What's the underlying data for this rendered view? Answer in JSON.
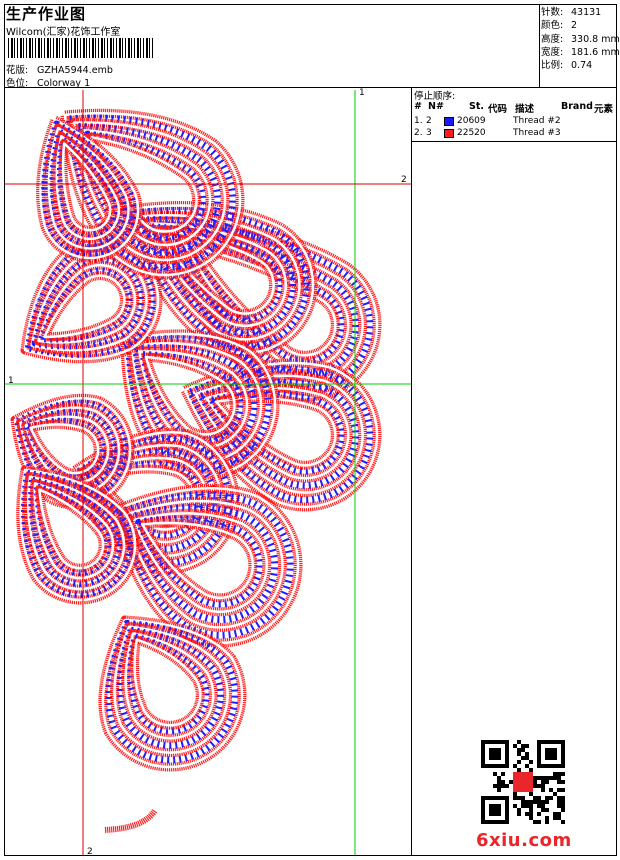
{
  "header": {
    "title": "生产作业图",
    "studio": "Wilcom(汇家)花饰工作室",
    "pattern_label": "花版:",
    "pattern_value": "GZHA5944.emb",
    "colorway_label": "色位:",
    "colorway_value": "Colorway 1"
  },
  "stats": [
    {
      "label": "针数:",
      "value": "43131"
    },
    {
      "label": "颜色:",
      "value": "2"
    },
    {
      "label": "高度:",
      "value": "330.8 mm"
    },
    {
      "label": "宽度:",
      "value": "181.6 mm"
    },
    {
      "label": "比例:",
      "value": "0.74"
    }
  ],
  "sequence": {
    "title": "停止顺序:",
    "headers": {
      "num": "#",
      "n": "N#",
      "st": "St.",
      "code": "代码",
      "desc": "描述",
      "brand": "Brand",
      "element": "元素"
    },
    "rows": [
      {
        "idx": "1.",
        "n": "2",
        "color": "#1a1aff",
        "code": "20609",
        "desc": "Thread #2"
      },
      {
        "idx": "2.",
        "n": "3",
        "color": "#ff1a1a",
        "code": "22520",
        "desc": "Thread #3"
      }
    ]
  },
  "guides": {
    "v1": "1",
    "v2": "2",
    "h1": "1",
    "h2": "2"
  },
  "watermark": {
    "logo": "6xiu.com"
  },
  "colors": {
    "red_thread": "#ff1f1f",
    "blue_thread": "#1f1fff",
    "guide_red": "#dd0000",
    "guide_green": "#00cc00"
  }
}
